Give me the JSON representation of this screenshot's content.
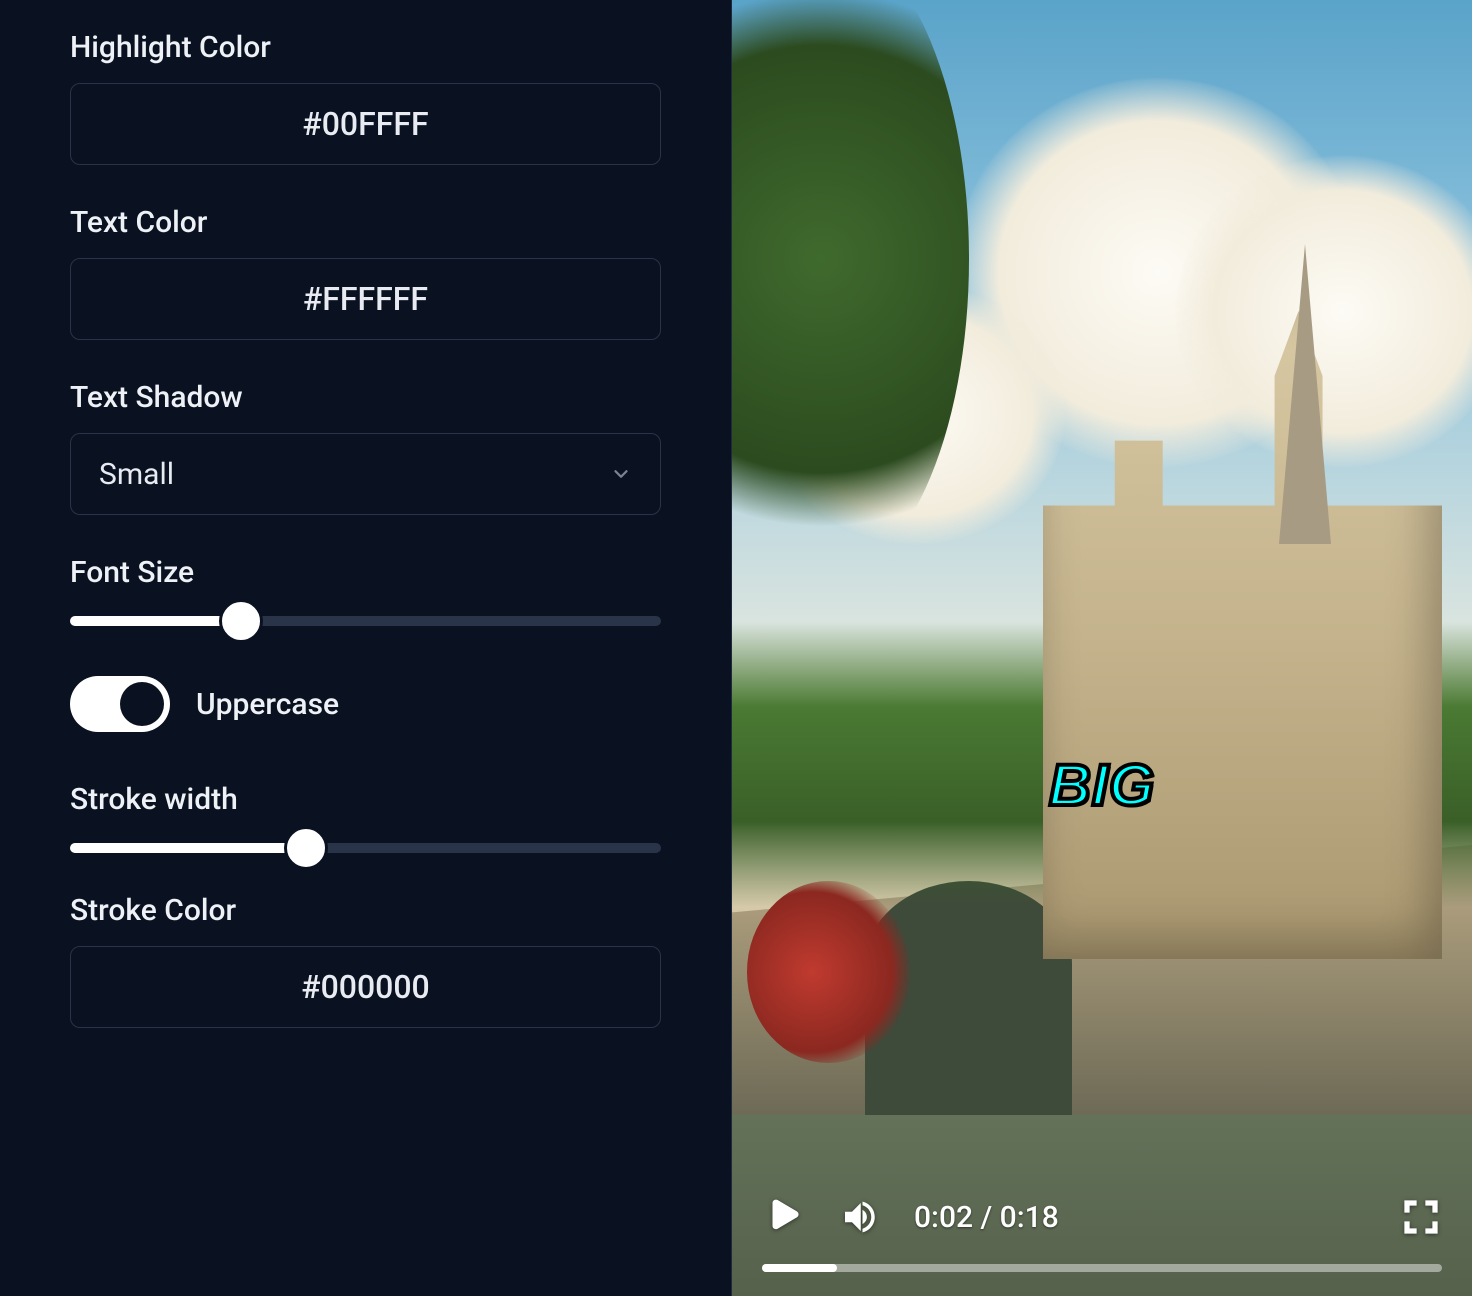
{
  "sidebar": {
    "highlight_color": {
      "label": "Highlight Color",
      "value": "#00FFFF"
    },
    "text_color": {
      "label": "Text Color",
      "value": "#FFFFFF"
    },
    "text_shadow": {
      "label": "Text Shadow",
      "value": "Small"
    },
    "font_size": {
      "label": "Font Size",
      "percent": 29
    },
    "uppercase": {
      "label": "Uppercase",
      "enabled": true
    },
    "stroke_width": {
      "label": "Stroke width",
      "percent": 40
    },
    "stroke_color": {
      "label": "Stroke Color",
      "value": "#000000"
    }
  },
  "preview": {
    "caption_text": "BIG",
    "controls": {
      "current_time": "0:02",
      "duration": "0:18",
      "time_display": "0:02 / 0:18",
      "progress_percent": 11
    }
  }
}
